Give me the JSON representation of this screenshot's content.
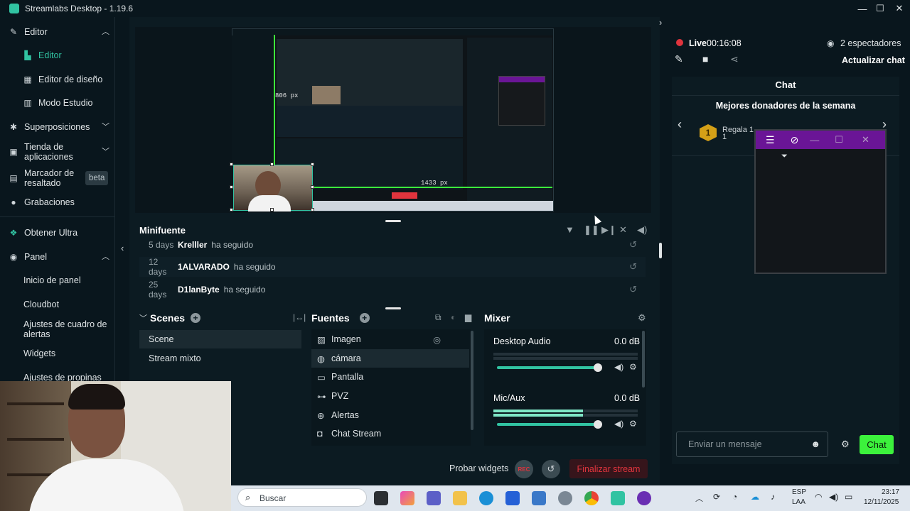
{
  "window": {
    "title": "Streamlabs Desktop - 1.19.6",
    "minimize": "—",
    "maximize": "☐",
    "close": "✕"
  },
  "sidebar": {
    "editor_section": "Editor",
    "editor_item": "Editor",
    "layout_editor": "Editor de diseño",
    "studio_mode": "Modo Estudio",
    "overlays": "Superposiciones",
    "app_store": "Tienda de aplicaciones",
    "highlighter": "Marcador de resaltado",
    "beta_badge": "beta",
    "recordings": "Grabaciones",
    "get_ultra": "Obtener Ultra",
    "panel": "Panel",
    "panel_home": "Inicio de panel",
    "cloudbot": "Cloudbot",
    "alert_box": "Ajustes de cuadro de alertas",
    "widgets": "Widgets",
    "tips": "Ajustes de propinas"
  },
  "preview": {
    "measure_width": "1433 px",
    "measure_height": "806 px"
  },
  "minifuente": {
    "title": "Minifuente",
    "events": [
      {
        "age": "5 days",
        "user": "Krelller",
        "action": "ha seguido"
      },
      {
        "age": "12 days",
        "user": "1ALVARADO",
        "action": "ha seguido"
      },
      {
        "age": "25 days",
        "user": "D1lanByte",
        "action": "ha seguido"
      }
    ]
  },
  "scenes": {
    "title": "Scenes",
    "items": [
      "Scene",
      "Stream mixto"
    ],
    "selected": "Scene"
  },
  "sources": {
    "title": "Fuentes",
    "items": [
      {
        "label": "Imagen",
        "icon": "image-icon"
      },
      {
        "label": "cámara",
        "icon": "camera-icon"
      },
      {
        "label": "Pantalla",
        "icon": "monitor-icon"
      },
      {
        "label": "PVZ",
        "icon": "gamepad-icon"
      },
      {
        "label": "Alertas",
        "icon": "globe-icon"
      },
      {
        "label": "Chat Stream",
        "icon": "chat-icon"
      }
    ],
    "selected": "cámara"
  },
  "mixer": {
    "title": "Mixer",
    "channels": [
      {
        "name": "Desktop Audio",
        "level": "0.0 dB",
        "volume": 1.0,
        "meter": 0.0
      },
      {
        "name": "Mic/Aux",
        "level": "0.0 dB",
        "volume": 1.0,
        "meter": 0.62
      }
    ]
  },
  "footer": {
    "test_widgets": "Probar widgets",
    "rec": "REC",
    "end_stream": "Finalizar stream"
  },
  "live": {
    "status": "Live",
    "timer": "00:16:08",
    "viewers": "2 espectadores",
    "refresh_chat": "Actualizar chat"
  },
  "chat": {
    "title": "Chat",
    "top_donors": "Mejores donadores de la semana",
    "donor_rank": "1",
    "donor_text": "Regala 1",
    "donor_text_2": "1",
    "placeholder": "Enviar un mensaje",
    "send_label": "Chat"
  },
  "taskbar": {
    "search_placeholder": "Buscar",
    "lang_1": "ESP",
    "lang_2": "LAA",
    "time": "23:17",
    "date": "12/11/2025"
  },
  "colors": {
    "accent": "#31c3a2",
    "live_red": "#e0343d",
    "chat_green": "#3cf23c",
    "end_stream_red": "#e0343d",
    "popup_purple": "#6a1596"
  }
}
